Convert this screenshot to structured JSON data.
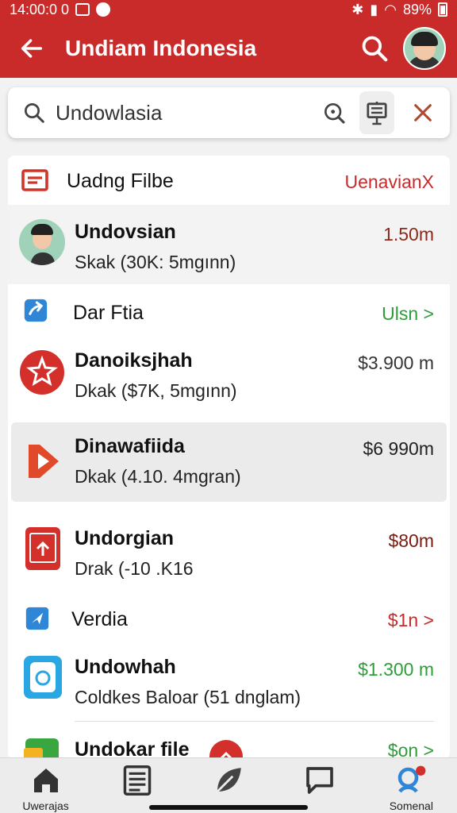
{
  "status": {
    "time": "14:00:0 0",
    "battery": "89%"
  },
  "appbar": {
    "title": "Undiam Indonesia"
  },
  "search": {
    "value": "Undowlasia"
  },
  "sections": [
    {
      "title": "Uadng Filbe",
      "action": "UenavianX",
      "action_color": "#c92a2a"
    },
    {
      "title": "Dar Ftia",
      "action": "Ulsn >",
      "action_color": "#2e9d3a"
    },
    {
      "title": "Verdia",
      "action": "$1n >",
      "action_color": "#c92a2a"
    }
  ],
  "items": [
    {
      "name": "Undovsian",
      "sub": "Skak (30K: 5mgınn)",
      "value": "1.50m",
      "value_color": "#8b2a1a",
      "icon": "person-avatar-icon"
    },
    {
      "name": "Danoiksjhah",
      "sub": "Dkak ($7K, 5mgınn)",
      "value": "$3.900 m",
      "value_color": "#333333",
      "icon": "red-badge-icon"
    },
    {
      "name": "Dinawafiida",
      "sub": "Dkak (4.10. 4mgran)",
      "value": "$6 990m",
      "value_color": "#222222",
      "icon": "play-icon"
    },
    {
      "name": "Undorgian",
      "sub": "Drak (-10 .K16",
      "value": "$80m",
      "value_color": "#7a1a10",
      "icon": "upload-box-icon"
    },
    {
      "name": "Undowhah",
      "sub": "Coldkes Baloar (51 dnglam)",
      "value": "$1.300 m",
      "value_color": "#2e9d3a",
      "icon": "device-icon"
    },
    {
      "name": "Undokar file",
      "sub": "",
      "value": "$on >",
      "value_color": "#2e9d3a",
      "icon": "green-doc-icon"
    }
  ],
  "nav": [
    {
      "label": "Uwerajas",
      "icon": "home-icon"
    },
    {
      "label": "",
      "icon": "document-icon"
    },
    {
      "label": "",
      "icon": "leaf-icon"
    },
    {
      "label": "",
      "icon": "chat-icon"
    },
    {
      "label": "Somenal",
      "icon": "profile-icon"
    }
  ]
}
